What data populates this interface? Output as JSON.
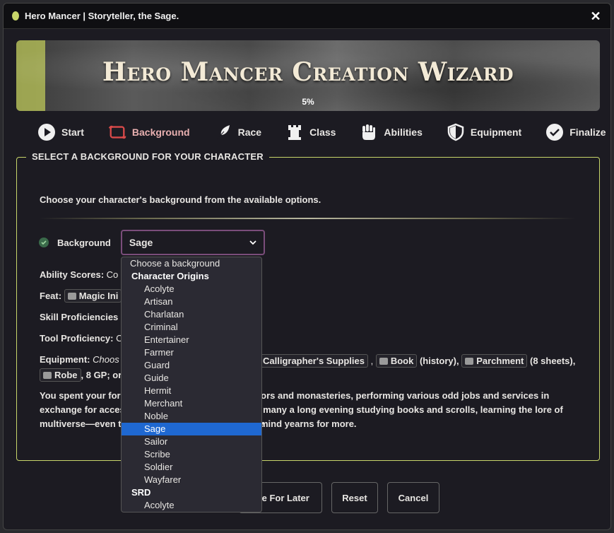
{
  "window": {
    "title": "Hero Mancer | Storyteller, the Sage."
  },
  "banner": {
    "title": "Hero Mancer Creation Wizard",
    "progress_percent": 5,
    "progress_label": "5%"
  },
  "steps": [
    {
      "label": "Start",
      "icon": "play-icon"
    },
    {
      "label": "Background",
      "icon": "scroll-icon"
    },
    {
      "label": "Race",
      "icon": "feather-icon"
    },
    {
      "label": "Class",
      "icon": "tower-icon"
    },
    {
      "label": "Abilities",
      "icon": "fist-icon"
    },
    {
      "label": "Equipment",
      "icon": "shield-icon"
    },
    {
      "label": "Finalize",
      "icon": "check-circle-icon"
    }
  ],
  "section": {
    "legend": "SELECT A BACKGROUND FOR YOUR CHARACTER",
    "intro": "Choose your character's background from the available options.",
    "background_label": "Background",
    "selected_background": "Sage"
  },
  "details": {
    "ability_label": "Ability Scores:",
    "ability_value": "Co",
    "feat_label": "Feat:",
    "feat_value": "Magic Ini",
    "skill_label": "Skill Proficiencies",
    "tool_label": "Tool Proficiency:",
    "tool_value": "C",
    "equipment_label": "Equipment:",
    "equipment_choose": "Choos",
    "calligrapher": "Calligrapher's Supplies",
    "book": "Book",
    "book_note": "(history),",
    "parchment": "Parchment",
    "parchment_note": "(8 sheets),",
    "robe": "Robe",
    "robe_note": ", 8 GP; or"
  },
  "description": {
    "line1_a": "You spent your form",
    "line1_b": "anors and monasteries, performing various odd jobs and services in",
    "line2_a": "exchange for acces",
    "line2_b": "ay many a long evening studying books and scrolls, learning the lore of the",
    "line3_a": "multiverse—even th",
    "line3_b": "mind yearns for more."
  },
  "dropdown": {
    "placeholder": "Choose a background",
    "group1": "Character Origins",
    "options": [
      "Acolyte",
      "Artisan",
      "Charlatan",
      "Criminal",
      "Entertainer",
      "Farmer",
      "Guard",
      "Guide",
      "Hermit",
      "Merchant",
      "Noble",
      "Sage",
      "Sailor",
      "Scribe",
      "Soldier",
      "Wayfarer"
    ],
    "group2": "SRD",
    "srd_options": [
      "Acolyte"
    ]
  },
  "footer": {
    "save_label": "ave For Later",
    "reset_label": "Reset",
    "cancel_label": "Cancel"
  },
  "colors": {
    "accent": "#c8d66a",
    "selected": "#1f68d1",
    "select_border": "#7a4d7a"
  }
}
